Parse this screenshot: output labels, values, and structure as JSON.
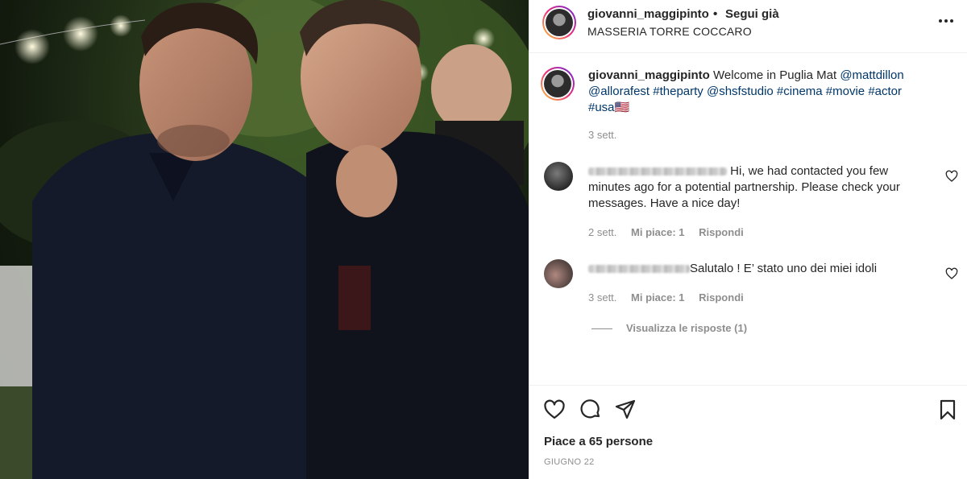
{
  "post": {
    "username": "giovanni_maggipinto",
    "separator": "•",
    "follow_label": "Segui già",
    "location": "MASSERIA TORRE COCCARO",
    "more_icon": "more-options-icon"
  },
  "caption": {
    "username": "giovanni_maggipinto",
    "text": "Welcome in Puglia Mat",
    "mention_1": "@mattdillon",
    "mention_2": "@allorafest",
    "hashtags": [
      "#theparty",
      "@shsfstudio",
      "#cinema",
      "#movie",
      "#actor",
      "#usa"
    ],
    "flag": "🇺🇸",
    "time": "3 sett."
  },
  "comments": [
    {
      "text": "Hi, we had contacted you few minutes ago for a potential partnership. Please check your messages. Have a nice day!",
      "time": "2 sett.",
      "likes": "Mi piace: 1",
      "reply": "Rispondi"
    },
    {
      "text": "Salutalo ! E’ stato uno dei miei idoli",
      "time": "3 sett.",
      "likes": "Mi piace: 1",
      "reply": "Rispondi"
    }
  ],
  "view_replies": "Visualizza le risposte (1)",
  "actions": {
    "likes_text": "Piace a 65 persone",
    "date": "GIUGNO 22"
  },
  "colors": {
    "link": "#00376b",
    "muted": "#8e8e8e",
    "text": "#262626"
  }
}
